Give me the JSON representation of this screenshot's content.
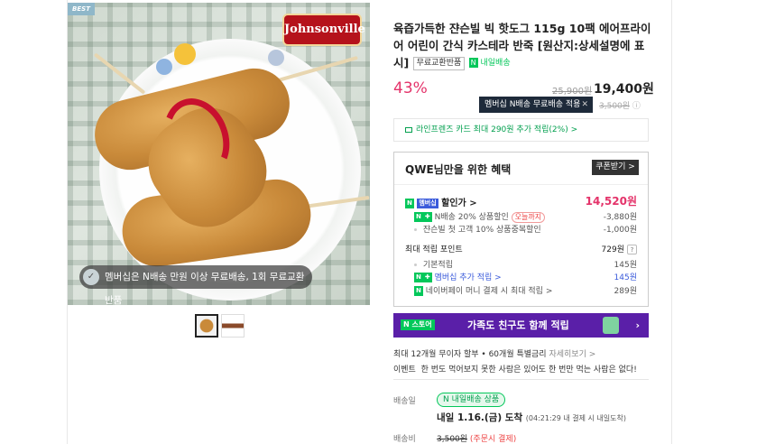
{
  "badge": "BEST",
  "brand_logo": "Johnsonville",
  "photo_banner": "멤버십은 N배송 만원 이상 무료배송, 1회 무료교환반품",
  "product": {
    "title": "육즙가득한 쟌슨빌 빅 핫도그 115g 10팩 에어프라이어 어린이 간식 카스테라 반죽 [원산지:상세설명에 표시]",
    "tag_return": "무료교환반품",
    "tag_today": "내일배송"
  },
  "price": {
    "discount": "43%",
    "original": "25,900원",
    "sale": "19,400원",
    "tooltip": "멤버십 N배송 무료배송 적용",
    "shipping_original": "3,500원"
  },
  "card_offer": "라인프렌즈 카드 최대 290원 추가 적립(2%) >",
  "benefit": {
    "header": "QWE님만을 위한 혜택",
    "coupon_button": "쿠폰받기 >",
    "discount_label": "할인가 >",
    "discount_value": "14,520원",
    "rows": [
      {
        "label": "N배송 20% 상품할인",
        "pill": "오늘까지",
        "value": "-3,880원"
      },
      {
        "label": "쟌슨빌 첫 고객 10% 상품중복할인",
        "value": "-1,000원"
      }
    ],
    "points_label": "최대 적립 포인트",
    "points_value": "729원",
    "point_rows": [
      {
        "label": "기본적립",
        "value": "145원"
      },
      {
        "label": "멤버십 추가 적립 >",
        "value": "145원"
      },
      {
        "label": "네이버페이 머니 결제 시 최대 적립 >",
        "value": "289원"
      }
    ]
  },
  "store_banner": {
    "badge": "N 스토어",
    "text": "가족도 친구도 함께 적립",
    "chevron": "›"
  },
  "installment": {
    "text": "최대 12개월 무이자 할부 • 60개월 특별금리",
    "link": "자세히보기 >"
  },
  "event": {
    "label": "이벤트",
    "text": "한 번도 먹어보지 못한 사람은 있어도 한 번만 먹는 사람은 없다!"
  },
  "delivery": {
    "label": "배송일",
    "tag": "내일배송 상품",
    "arrive": "내일 1.16.(금) 도착",
    "arrive_sub": "(04:21:29 내 결제 시 내일도착)"
  },
  "fee": {
    "label": "배송비",
    "original": "3,500원",
    "note": "(주문시 결제)"
  },
  "colors": {
    "discount": "#e4336a",
    "naver_green": "#03c75a",
    "store_purple": "#5a1fa8"
  }
}
